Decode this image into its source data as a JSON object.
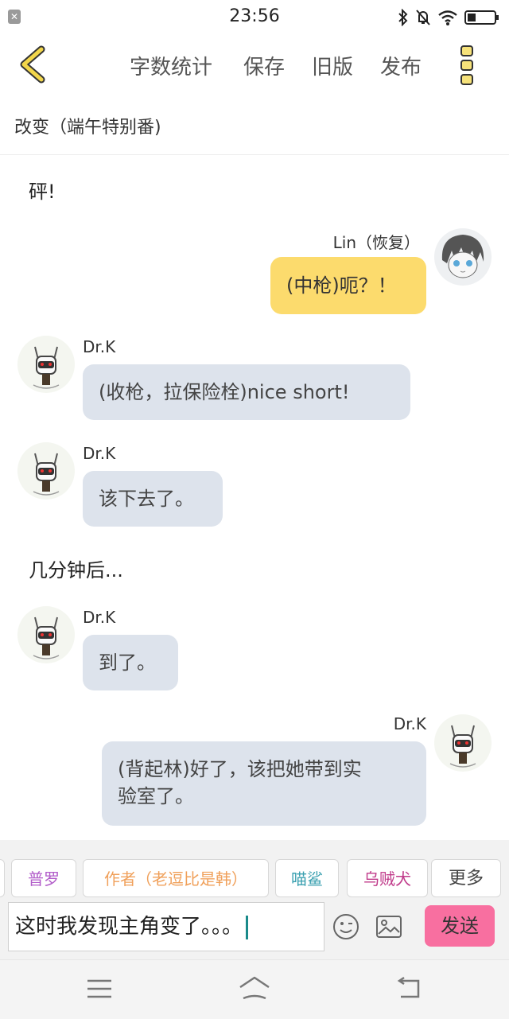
{
  "status": {
    "time": "23:56",
    "notification_icon": "close-x"
  },
  "toolbar": {
    "items": [
      "字数统计",
      "保存",
      "旧版",
      "发布"
    ],
    "accent": "#f2c94c"
  },
  "doc_title": "改变（端午特别番)",
  "chat": {
    "narration_1": "砰!",
    "msg1": {
      "name": "Lin（恢复）",
      "text": "(中枪)呃？！"
    },
    "msg2": {
      "name": "Dr.K",
      "text": "(收枪，拉保险栓)nice short!"
    },
    "msg3": {
      "name": "Dr.K",
      "text": "该下去了。"
    },
    "narration_2": "几分钟后...",
    "msg4": {
      "name": "Dr.K",
      "text": "到了。"
    },
    "msg5": {
      "name": "Dr.K",
      "line1": "(背起林)好了，该把她带到实",
      "line2": "验室了。"
    }
  },
  "characters": [
    {
      "label": "普罗",
      "color": "#b15bc9"
    },
    {
      "label": "作者（老逗比是韩）",
      "color": "#f0a05a"
    },
    {
      "label": "喵鲨",
      "color": "#3aa0b0"
    },
    {
      "label": "乌贼犬",
      "color": "#c03a8a"
    },
    {
      "label": "更多",
      "color": "#444444"
    }
  ],
  "composer": {
    "text": "这时我发现主角变了。。。",
    "send_label": "发送",
    "send_color": "#f86fa0"
  }
}
